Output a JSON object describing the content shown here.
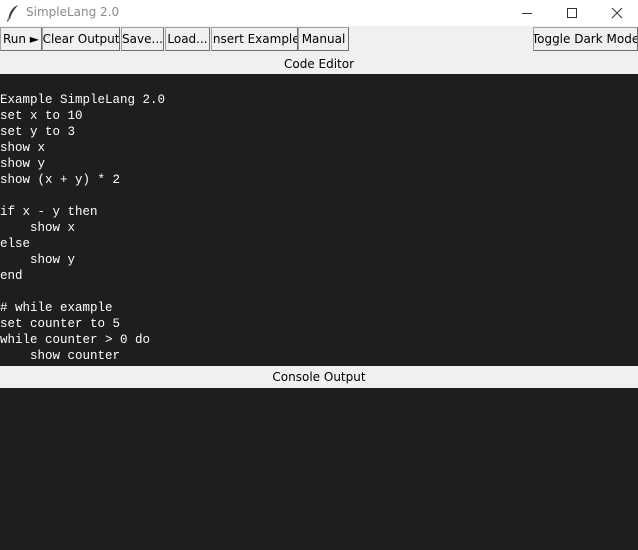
{
  "window": {
    "title": "SimpleLang 2.0",
    "icon": "feather-icon"
  },
  "toolbar": {
    "run_label": "Run ►",
    "clear_output_label": "Clear Output",
    "save_label": "Save...",
    "load_label": "Load...",
    "insert_example_label": "Insert Example",
    "manual_label": "Manual",
    "toggle_dark_mode_label": "Toggle Dark Mode"
  },
  "editor": {
    "header": "Code Editor",
    "code": "Example SimpleLang 2.0\nset x to 10\nset y to 3\nshow x\nshow y\nshow (x + y) * 2\n\nif x - y then\n    show x\nelse\n    show y\nend\n\n# while example\nset counter to 5\nwhile counter > 0 do\n    show counter"
  },
  "console": {
    "header": "Console Output",
    "output": ""
  },
  "colors": {
    "editor_bg": "#1e1e1e",
    "editor_fg": "#ffffff",
    "chrome_bg": "#f0f0f0"
  }
}
